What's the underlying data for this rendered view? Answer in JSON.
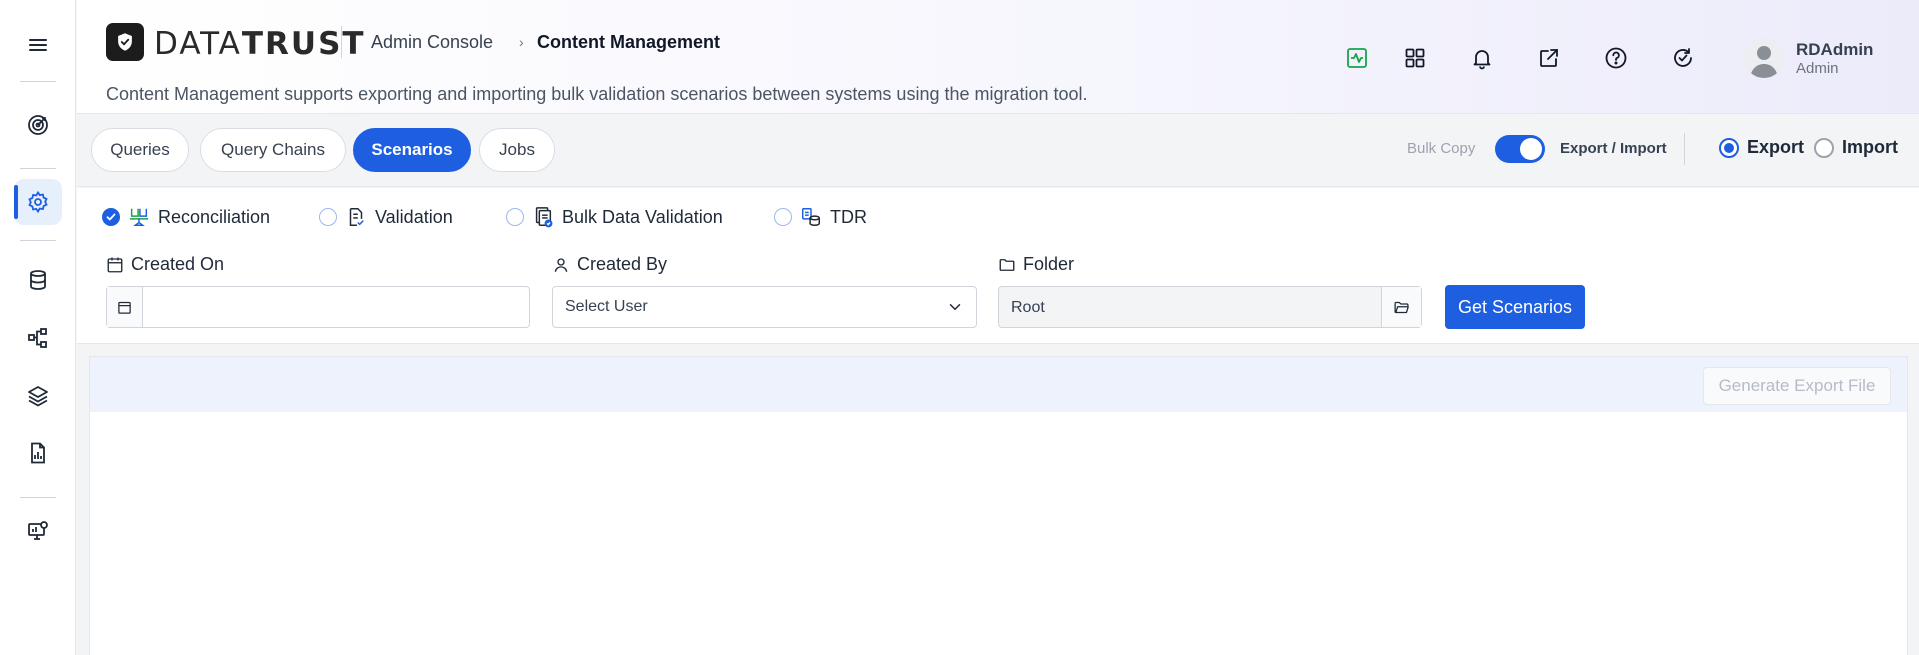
{
  "app": {
    "logo_text_light": "DATA",
    "logo_text_bold": "TRUST"
  },
  "breadcrumb": {
    "root": "Admin Console",
    "current": "Content Management"
  },
  "header": {
    "description": "Content Management supports exporting and importing bulk validation scenarios between systems using the migration tool."
  },
  "user": {
    "name": "RDAdmin",
    "role": "Admin"
  },
  "sidebar": {
    "items": [
      {
        "icon": "menu-icon"
      },
      {
        "icon": "target-icon"
      },
      {
        "icon": "gear-icon",
        "active": true
      },
      {
        "icon": "database-icon"
      },
      {
        "icon": "network-icon"
      },
      {
        "icon": "layers-icon"
      },
      {
        "icon": "report-icon"
      },
      {
        "icon": "monitor-settings-icon"
      }
    ]
  },
  "header_icons": [
    "activity-icon",
    "grid-icon",
    "bell-icon",
    "external-link-icon",
    "help-icon",
    "refresh-check-icon"
  ],
  "tabs": [
    {
      "label": "Queries"
    },
    {
      "label": "Query Chains"
    },
    {
      "label": "Scenarios",
      "active": true
    },
    {
      "label": "Jobs"
    }
  ],
  "mode": {
    "bulk_copy_label": "Bulk Copy",
    "export_import_label": "Export / Import",
    "toggle_on": true,
    "export_label": "Export",
    "import_label": "Import",
    "selected": "Export"
  },
  "scenario_types": [
    {
      "label": "Reconciliation",
      "checked": true
    },
    {
      "label": "Validation",
      "checked": false
    },
    {
      "label": "Bulk Data Validation",
      "checked": false
    },
    {
      "label": "TDR",
      "checked": false
    }
  ],
  "filters": {
    "created_on_label": "Created On",
    "created_on_value": "",
    "created_by_label": "Created By",
    "created_by_value": "Select User",
    "folder_label": "Folder",
    "folder_value": "Root",
    "get_button": "Get Scenarios"
  },
  "panel": {
    "generate_button": "Generate Export File"
  },
  "colors": {
    "primary": "#1d5fe0",
    "activity_icon": "#16a34a"
  }
}
